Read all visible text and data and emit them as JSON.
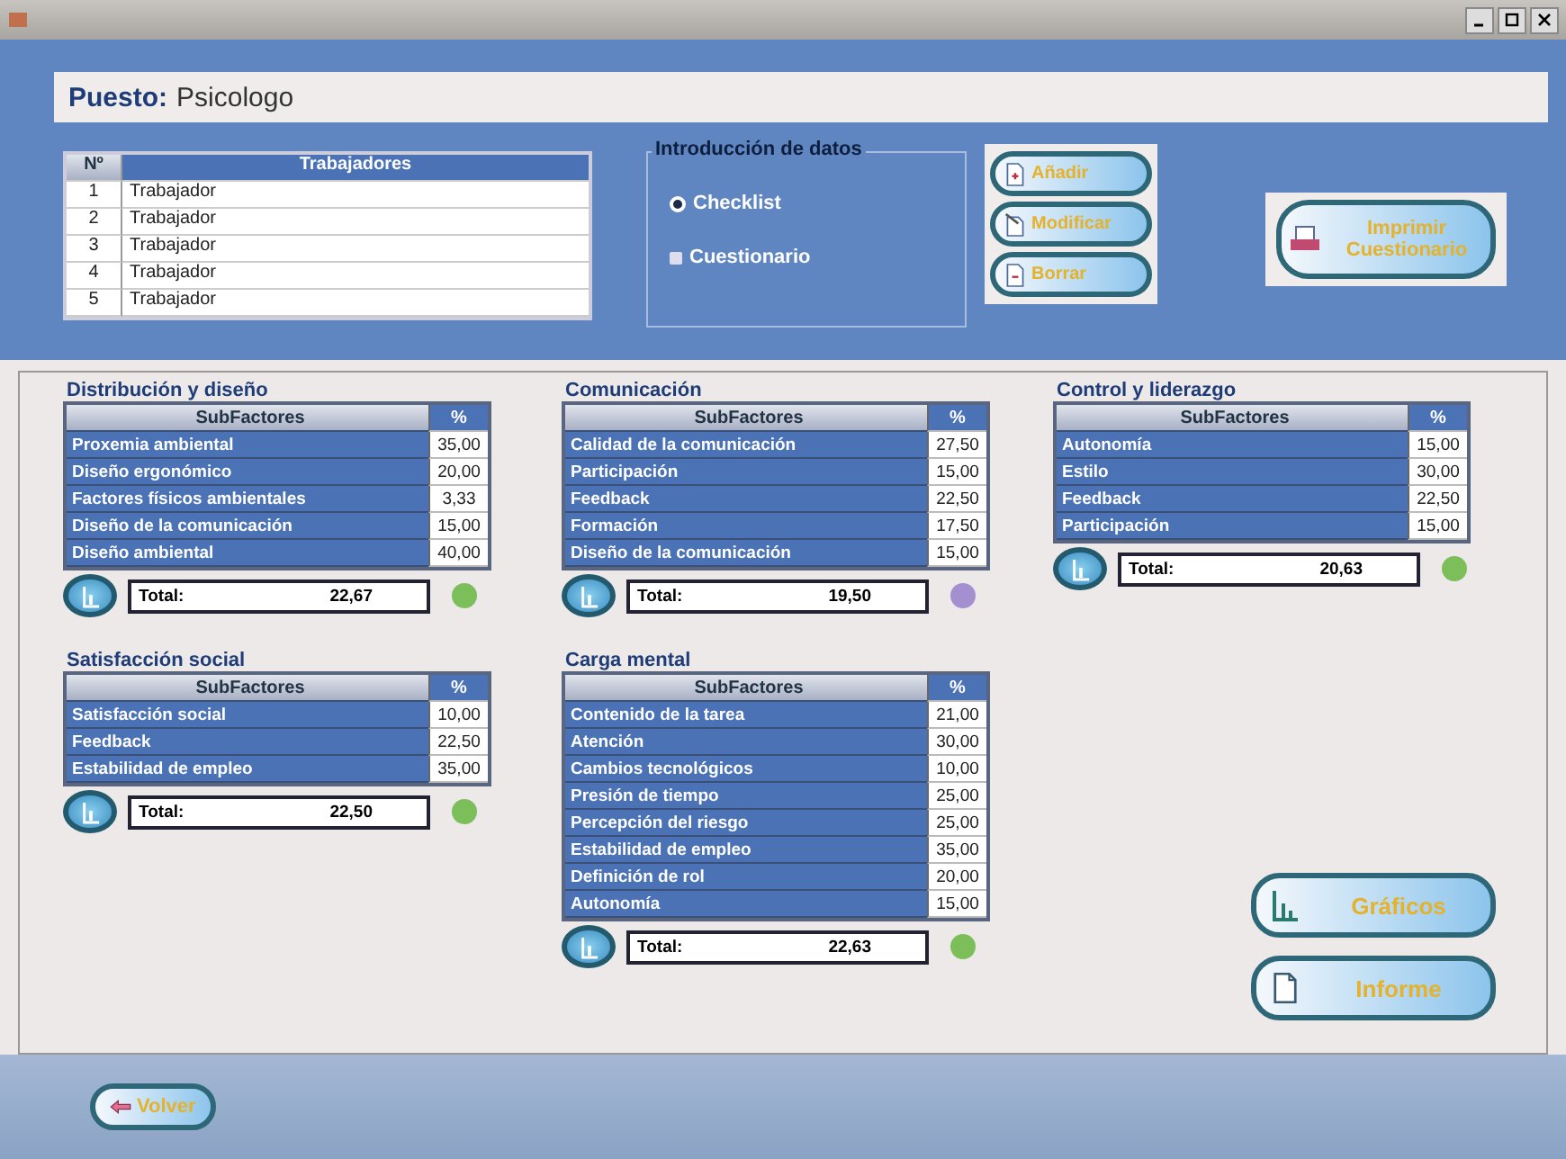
{
  "puesto": {
    "label": "Puesto:",
    "value": "Psicologo"
  },
  "workers": {
    "columns": [
      "Nº",
      "Trabajadores"
    ],
    "rows": [
      {
        "n": "1",
        "name": "Trabajador"
      },
      {
        "n": "2",
        "name": "Trabajador"
      },
      {
        "n": "3",
        "name": "Trabajador"
      },
      {
        "n": "4",
        "name": "Trabajador"
      },
      {
        "n": "5",
        "name": "Trabajador"
      }
    ]
  },
  "data_entry": {
    "title": "Introducción de datos",
    "options": [
      {
        "label": "Checklist",
        "selected": true
      },
      {
        "label": "Cuestionario",
        "selected": false
      }
    ]
  },
  "record_buttons": [
    {
      "label": "Añadir",
      "kind": "add"
    },
    {
      "label": "Modificar",
      "kind": "edit"
    },
    {
      "label": "Borrar",
      "kind": "delete"
    }
  ],
  "print_button": {
    "label": "Imprimir Cuestionario"
  },
  "section_columns": [
    [
      {
        "title": "Distribución y diseño",
        "columns": [
          "SubFactores",
          "%"
        ],
        "rows": [
          {
            "name": "Proxemia ambiental",
            "value": "35,00"
          },
          {
            "name": "Diseño ergonómico",
            "value": "20,00"
          },
          {
            "name": "Factores físicos ambientales",
            "value": "3,33"
          },
          {
            "name": "Diseño de la comunicación",
            "value": "15,00"
          },
          {
            "name": "Diseño ambiental",
            "value": "40,00"
          }
        ],
        "total_label": "Total:",
        "total": "22,67",
        "color": "#7cbf5a"
      },
      {
        "title": "Satisfacción social",
        "columns": [
          "SubFactores",
          "%"
        ],
        "rows": [
          {
            "name": "Satisfacción social",
            "value": "10,00"
          },
          {
            "name": "Feedback",
            "value": "22,50"
          },
          {
            "name": "Estabilidad de empleo",
            "value": "35,00"
          }
        ],
        "total_label": "Total:",
        "total": "22,50",
        "color": "#7cbf5a"
      }
    ],
    [
      {
        "title": "Comunicación",
        "columns": [
          "SubFactores",
          "%"
        ],
        "rows": [
          {
            "name": "Calidad de la comunicación",
            "value": "27,50"
          },
          {
            "name": "Participación",
            "value": "15,00"
          },
          {
            "name": "Feedback",
            "value": "22,50"
          },
          {
            "name": "Formación",
            "value": "17,50"
          },
          {
            "name": "Diseño de la comunicación",
            "value": "15,00"
          }
        ],
        "total_label": "Total:",
        "total": "19,50",
        "color": "#a48fd0"
      },
      {
        "title": "Carga mental",
        "columns": [
          "SubFactores",
          "%"
        ],
        "rows": [
          {
            "name": "Contenido de la tarea",
            "value": "21,00"
          },
          {
            "name": "Atención",
            "value": "30,00"
          },
          {
            "name": "Cambios tecnológicos",
            "value": "10,00"
          },
          {
            "name": "Presión de tiempo",
            "value": "25,00"
          },
          {
            "name": "Percepción del riesgo",
            "value": "25,00"
          },
          {
            "name": "Estabilidad de empleo",
            "value": "35,00"
          },
          {
            "name": "Definición de rol",
            "value": "20,00"
          },
          {
            "name": "Autonomía",
            "value": "15,00"
          }
        ],
        "total_label": "Total:",
        "total": "22,63",
        "color": "#7cbf5a"
      }
    ],
    [
      {
        "title": "Control y liderazgo",
        "columns": [
          "SubFactores",
          "%"
        ],
        "rows": [
          {
            "name": "Autonomía",
            "value": "15,00"
          },
          {
            "name": "Estilo",
            "value": "30,00"
          },
          {
            "name": "Feedback",
            "value": "22,50"
          },
          {
            "name": "Participación",
            "value": "15,00"
          }
        ],
        "total_label": "Total:",
        "total": "20,63",
        "color": "#7cbf5a"
      }
    ]
  ],
  "side_buttons": [
    {
      "label": "Gráficos",
      "kind": "chart"
    },
    {
      "label": "Informe",
      "kind": "report"
    }
  ],
  "back_button": {
    "label": "Volver"
  }
}
